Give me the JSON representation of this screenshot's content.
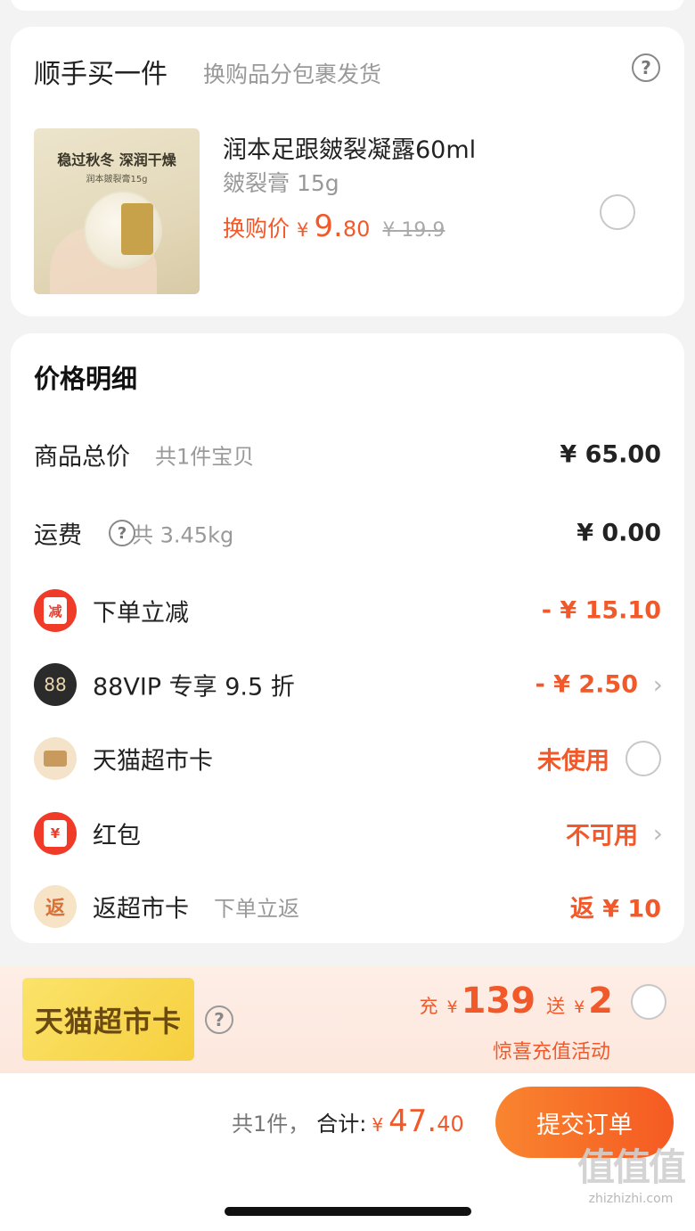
{
  "addon": {
    "title": "顺手买一件",
    "subtitle": "换购品分包裹发货",
    "help_icon": "?",
    "product": {
      "image_headline": "稳过秋冬 深润干燥",
      "image_sub": "润本皴裂膏15g",
      "name": "润本足跟皴裂凝露60ml",
      "spec": "皴裂膏 15g",
      "price_label": "换购价",
      "currency": "¥",
      "price_int": "9.",
      "price_dec": "80",
      "original_price": "¥ 19.9"
    }
  },
  "price_detail": {
    "title": "价格明细",
    "rows": [
      {
        "label": "商品总价",
        "note": "共1件宝贝",
        "value": "¥ 65.00"
      },
      {
        "label": "运费",
        "help": "?",
        "note": "共 3.45kg",
        "value": "¥ 0.00"
      },
      {
        "icon_text": "减",
        "label": "下单立减",
        "value": "- ¥ 15.10"
      },
      {
        "icon_text": "88",
        "label": "88VIP 专享 9.5 折",
        "value": "- ¥ 2.50"
      },
      {
        "label": "天猫超市卡",
        "value": "未使用"
      },
      {
        "icon_text": "¥",
        "label": "红包",
        "value": "不可用"
      },
      {
        "icon_text": "返",
        "label": "返超市卡",
        "note": "下单立返",
        "value": "返 ¥ 10"
      }
    ]
  },
  "promo": {
    "badge": "天猫超市卡",
    "help": "?",
    "recharge_label": "充",
    "currency": "¥",
    "recharge_amount": "139",
    "gift_label": "送",
    "gift_amount": "2",
    "caption": "惊喜充值活动"
  },
  "bottom": {
    "count": "共1件，",
    "total_label": "合计:",
    "currency": "¥",
    "total_int": "47.",
    "total_dec": "40",
    "submit": "提交订单"
  },
  "watermark": {
    "logo": "值值值",
    "url": "zhizhizhi.com"
  },
  "colors": {
    "accent": "#f2592a",
    "submit_gradient_start": "#f9852f",
    "submit_gradient_end": "#f55a22",
    "badge_yellow": "#f6cf3e"
  },
  "icons": [
    "help-circle-icon",
    "coupon-reduce-icon",
    "vip-88-icon",
    "supermarket-card-icon",
    "red-packet-icon",
    "cashback-icon",
    "chevron-right-icon",
    "radio-unchecked-icon"
  ]
}
